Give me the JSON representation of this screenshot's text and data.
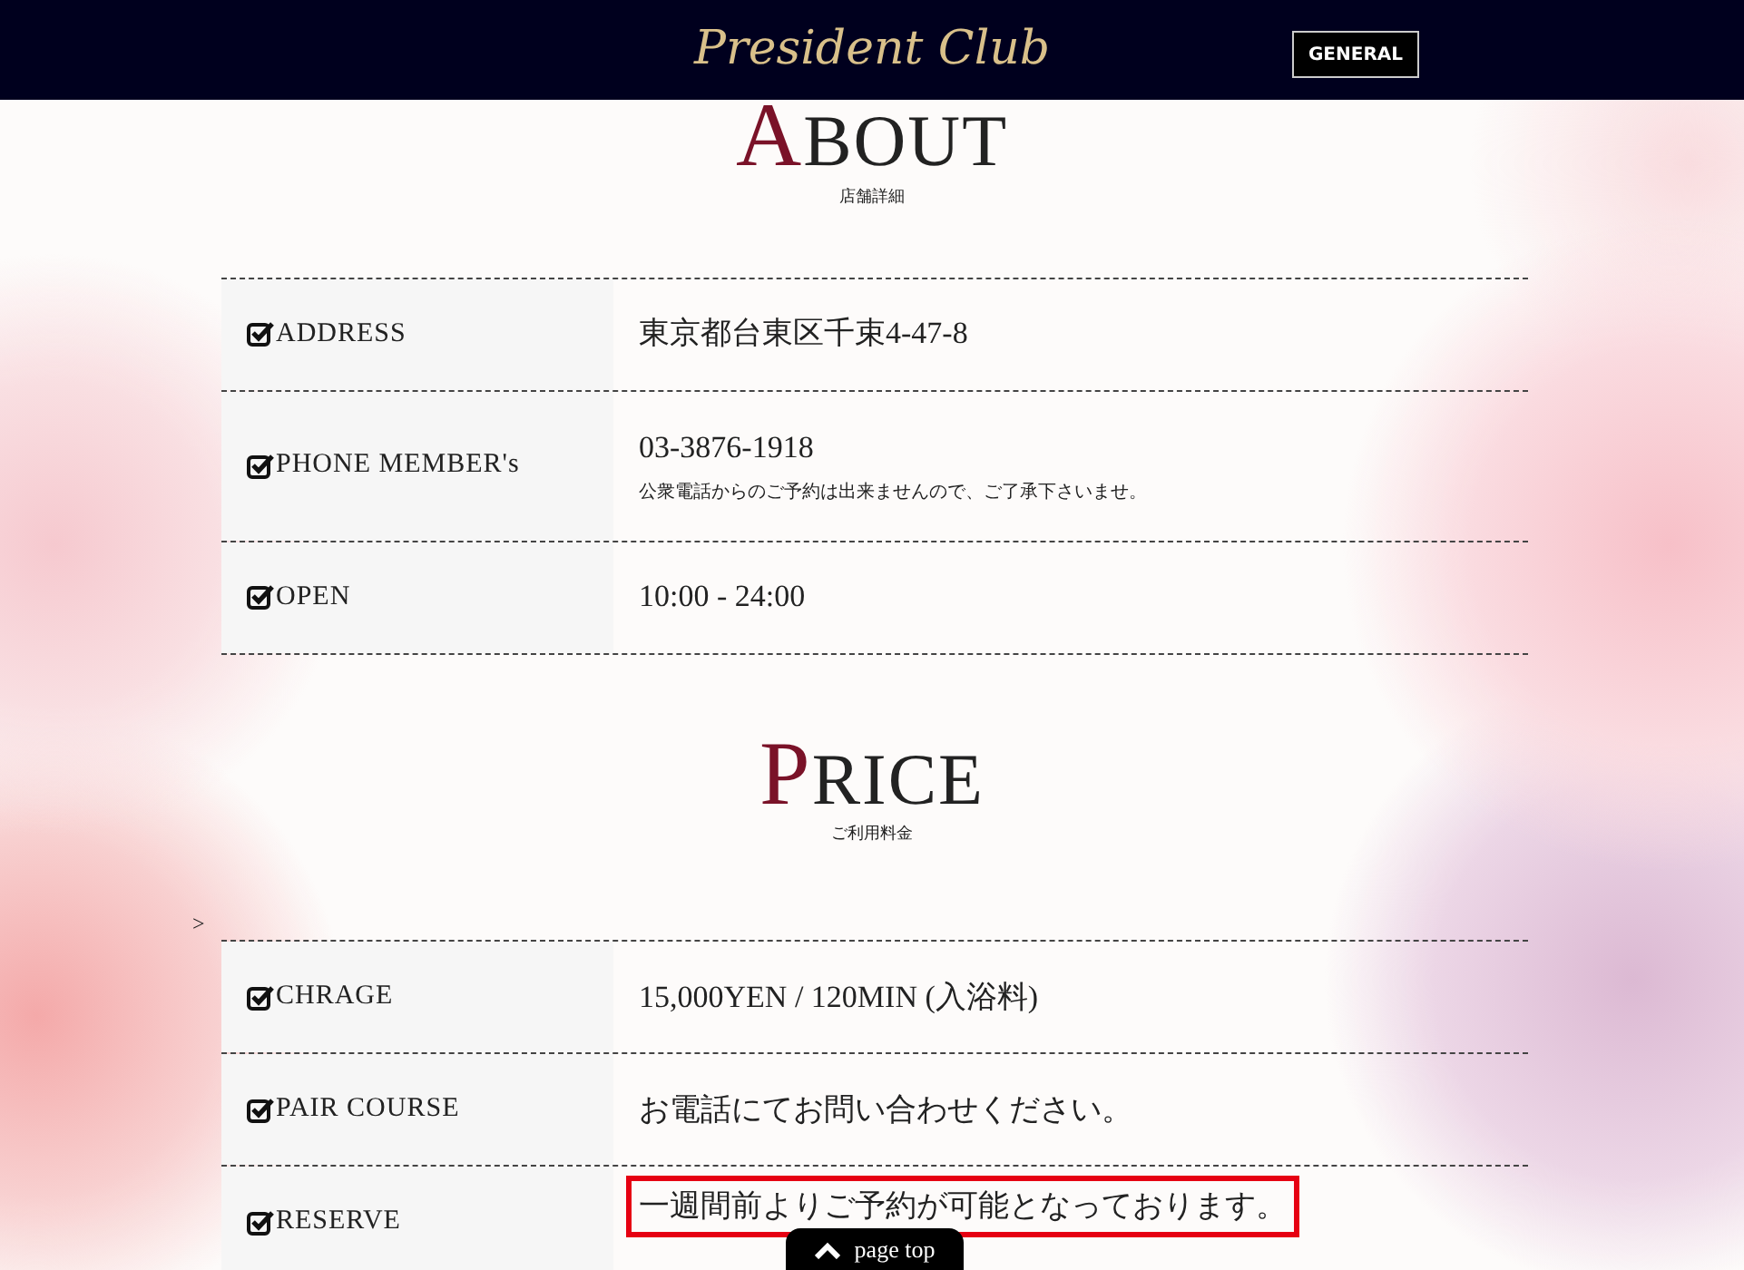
{
  "header": {
    "logo": "President Club",
    "button": "GENERAL"
  },
  "sections": [
    {
      "title_initial": "A",
      "title_rest": "BOUT",
      "subtitle": "店舗詳細",
      "rows": [
        {
          "label": "ADDRESS",
          "value": "東京都台東区千束4-47-8",
          "highlighted": false
        },
        {
          "label": "PHONE MEMBER's",
          "value": "03-3876-1918",
          "note": "公衆電話からのご予約は出来ませんので、ご了承下さいませ。",
          "highlighted": false
        },
        {
          "label": "OPEN",
          "value": "10:00 - 24:00",
          "highlighted": false
        }
      ]
    },
    {
      "title_initial": "P",
      "title_rest": "RICE",
      "subtitle": "ご利用料金",
      "marker": ">",
      "rows": [
        {
          "label": "CHRAGE",
          "value": "15,000YEN / 120MIN (入浴料)",
          "highlighted": false
        },
        {
          "label": "PAIR COURSE",
          "value": "お電話にてお問い合わせください。",
          "highlighted": false
        },
        {
          "label": "RESERVE",
          "value": "一週間前よりご予約が可能となっております。",
          "highlighted": true
        }
      ]
    }
  ],
  "page_top": "page top"
}
